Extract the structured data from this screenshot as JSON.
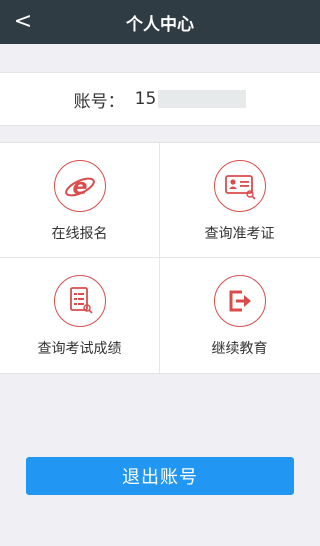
{
  "header": {
    "title": "个人中心",
    "back_glyph": "<"
  },
  "account": {
    "label": "账号：",
    "value_visible": "15"
  },
  "menu": [
    {
      "label": "在线报名",
      "icon": "ie-logo-icon"
    },
    {
      "label": "查询准考证",
      "icon": "id-card-icon"
    },
    {
      "label": "查询考试成绩",
      "icon": "score-report-icon"
    },
    {
      "label": "继续教育",
      "icon": "exit-arrow-icon"
    }
  ],
  "logout": {
    "label": "退出账号"
  },
  "colors": {
    "header_bg": "#2f3c44",
    "accent_red": "#d94c4c",
    "button_blue": "#2196f3",
    "page_bg": "#efeff4"
  }
}
